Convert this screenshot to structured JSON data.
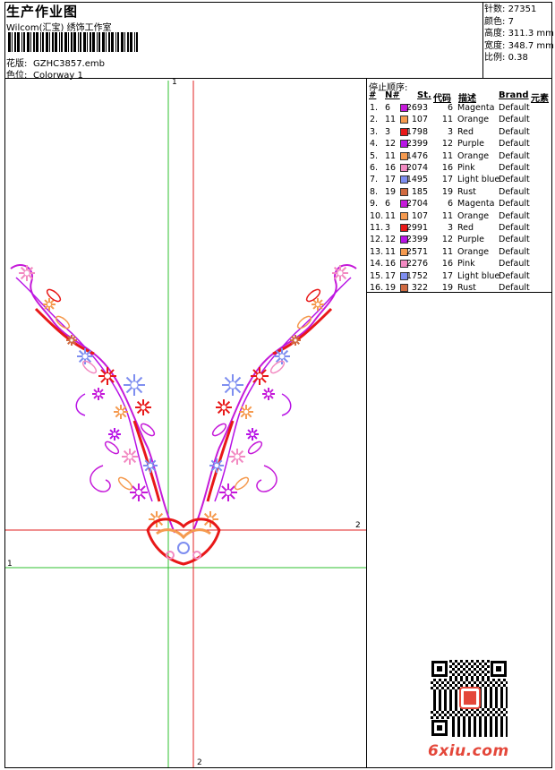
{
  "header": {
    "title": "生产作业图",
    "company": "Wilcom(汇宝) 绣饰工作室",
    "design_label": "花版:",
    "design_value": "GZHC3857.emb",
    "colorway_label": "色位:",
    "colorway_value": "Colorway 1"
  },
  "stats": [
    {
      "label": "针数:",
      "value": "27351"
    },
    {
      "label": "颜色:",
      "value": "7"
    },
    {
      "label": "高度:",
      "value": "311.3 mm"
    },
    {
      "label": "宽度:",
      "value": "348.7 mm"
    },
    {
      "label": "比例:",
      "value": "0.38"
    }
  ],
  "stop_sequence": {
    "title": "停止顺序:",
    "columns": [
      "#",
      "N#",
      "St.",
      "代码",
      "描述",
      "Brand",
      "元素"
    ],
    "rows": [
      {
        "idx": "1.",
        "n": "6",
        "color": "#c51ad9",
        "st": "2693",
        "code": "6",
        "desc": "Magenta",
        "brand": "Default"
      },
      {
        "idx": "2.",
        "n": "11",
        "color": "#f59a4f",
        "st": "107",
        "code": "11",
        "desc": "Orange",
        "brand": "Default"
      },
      {
        "idx": "3.",
        "n": "3",
        "color": "#e81818",
        "st": "1798",
        "code": "3",
        "desc": "Red",
        "brand": "Default"
      },
      {
        "idx": "4.",
        "n": "12",
        "color": "#b814e6",
        "st": "2399",
        "code": "12",
        "desc": "Purple",
        "brand": "Default"
      },
      {
        "idx": "5.",
        "n": "11",
        "color": "#f59a4f",
        "st": "1476",
        "code": "11",
        "desc": "Orange",
        "brand": "Default"
      },
      {
        "idx": "6.",
        "n": "16",
        "color": "#f28ac2",
        "st": "2074",
        "code": "16",
        "desc": "Pink",
        "brand": "Default"
      },
      {
        "idx": "7.",
        "n": "17",
        "color": "#7e8ef0",
        "st": "1495",
        "code": "17",
        "desc": "Light blue",
        "brand": "Default"
      },
      {
        "idx": "8.",
        "n": "19",
        "color": "#d06a40",
        "st": "185",
        "code": "19",
        "desc": "Rust",
        "brand": "Default"
      },
      {
        "idx": "9.",
        "n": "6",
        "color": "#c51ad9",
        "st": "2704",
        "code": "6",
        "desc": "Magenta",
        "brand": "Default"
      },
      {
        "idx": "10.",
        "n": "11",
        "color": "#f59a4f",
        "st": "107",
        "code": "11",
        "desc": "Orange",
        "brand": "Default"
      },
      {
        "idx": "11.",
        "n": "3",
        "color": "#e81818",
        "st": "2991",
        "code": "3",
        "desc": "Red",
        "brand": "Default"
      },
      {
        "idx": "12.",
        "n": "12",
        "color": "#b814e6",
        "st": "2399",
        "code": "12",
        "desc": "Purple",
        "brand": "Default"
      },
      {
        "idx": "13.",
        "n": "11",
        "color": "#f59a4f",
        "st": "2571",
        "code": "11",
        "desc": "Orange",
        "brand": "Default"
      },
      {
        "idx": "14.",
        "n": "16",
        "color": "#f28ac2",
        "st": "2276",
        "code": "16",
        "desc": "Pink",
        "brand": "Default"
      },
      {
        "idx": "15.",
        "n": "17",
        "color": "#7e8ef0",
        "st": "1752",
        "code": "17",
        "desc": "Light blue",
        "brand": "Default"
      },
      {
        "idx": "16.",
        "n": "19",
        "color": "#d06a40",
        "st": "322",
        "code": "19",
        "desc": "Rust",
        "brand": "Default"
      }
    ]
  },
  "guides": {
    "v1_label": "1",
    "v2_label": "2",
    "h1_label": "1",
    "h2_label": "2",
    "green": "#2fc02f",
    "red": "#e02020"
  },
  "watermark": {
    "site": "6xiu.com",
    "icon": "qr-code-icon",
    "accent": "#e4473a"
  }
}
